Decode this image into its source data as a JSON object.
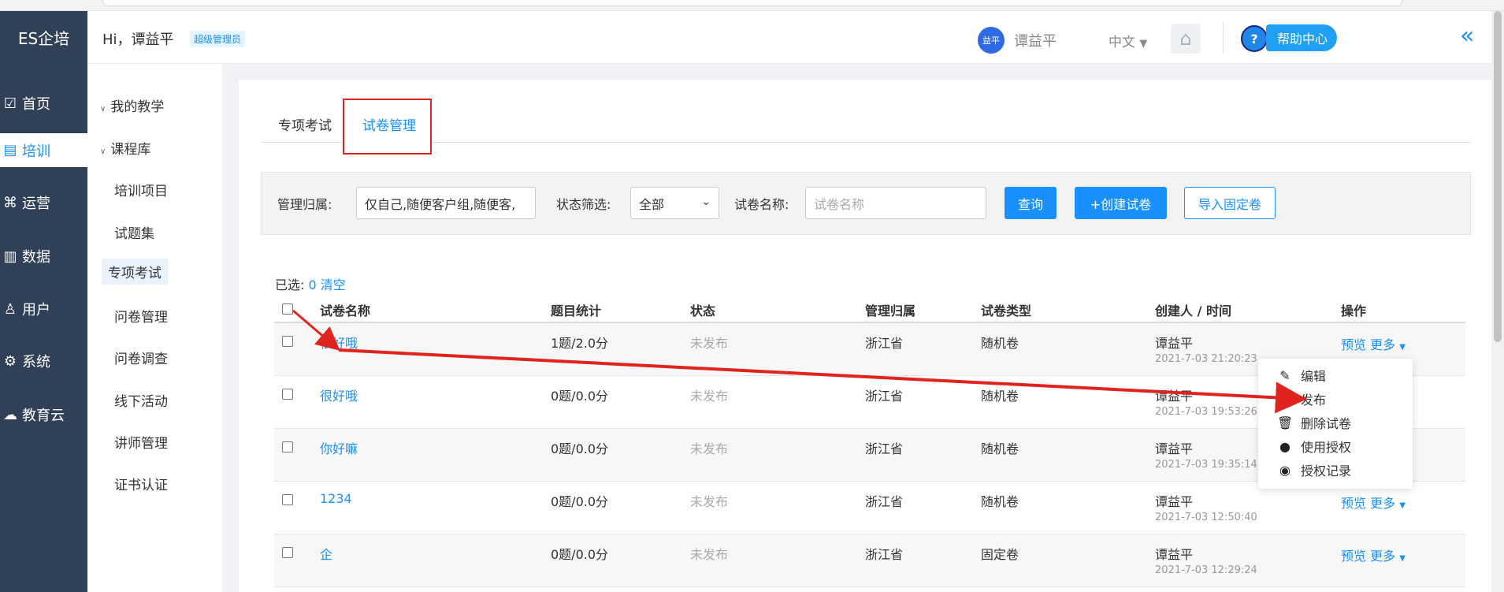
{
  "app": {
    "logo": "ES企培"
  },
  "sidebar": {
    "items": [
      {
        "label": "首页",
        "icon": "chart-icon"
      },
      {
        "label": "培训",
        "icon": "book-icon",
        "active": true
      },
      {
        "label": "运营",
        "icon": "command-icon"
      },
      {
        "label": "数据",
        "icon": "bars-icon"
      },
      {
        "label": "用户",
        "icon": "user-icon"
      },
      {
        "label": "系统",
        "icon": "gear-icon"
      },
      {
        "label": "教育云",
        "icon": "cloud-icon"
      }
    ]
  },
  "header": {
    "greeting": "Hi，谭益平",
    "role": "超级管理员",
    "avatar_text": "益平",
    "username": "谭益平",
    "language": "中文",
    "help": "帮助中心"
  },
  "submenu": {
    "groups": [
      "我的教学",
      "课程库"
    ],
    "items": [
      "培训项目",
      "试题集",
      "专项考试",
      "问卷管理",
      "问卷调查",
      "线下活动",
      "讲师管理",
      "证书认证"
    ]
  },
  "tabs": [
    "专项考试",
    "试卷管理"
  ],
  "filter": {
    "owner_label": "管理归属:",
    "owner_value": "仅自己,随便客户组,随便客,",
    "status_label": "状态筛选:",
    "status_value": "全部",
    "name_label": "试卷名称:",
    "name_placeholder": "试卷名称",
    "query_btn": "查询",
    "create_btn": "+创建试卷",
    "import_btn": "导入固定卷"
  },
  "selection": {
    "prefix": "已选:",
    "count": "0",
    "clear": "清空"
  },
  "table": {
    "headers": [
      "试卷名称",
      "题目统计",
      "状态",
      "管理归属",
      "试卷类型",
      "创建人 / 时间",
      "操作"
    ],
    "rows": [
      {
        "name": "很好哦",
        "stats": "1题/2.0分",
        "status": "未发布",
        "owner": "浙江省",
        "type": "随机卷",
        "creator": "谭益平",
        "time": "2021-7-03 21:20:23"
      },
      {
        "name": "很好哦",
        "stats": "0题/0.0分",
        "status": "未发布",
        "owner": "浙江省",
        "type": "随机卷",
        "creator": "谭益平",
        "time": "2021-7-03 19:53:26"
      },
      {
        "name": "你好嘛",
        "stats": "0题/0.0分",
        "status": "未发布",
        "owner": "浙江省",
        "type": "随机卷",
        "creator": "谭益平",
        "time": "2021-7-03 19:35:14"
      },
      {
        "name": "1234",
        "stats": "0题/0.0分",
        "status": "未发布",
        "owner": "浙江省",
        "type": "随机卷",
        "creator": "谭益平",
        "time": "2021-7-03 12:50:40"
      },
      {
        "name": "企",
        "stats": "0题/0.0分",
        "status": "未发布",
        "owner": "浙江省",
        "type": "固定卷",
        "creator": "谭益平",
        "time": "2021-7-03 12:29:24"
      }
    ],
    "op_preview": "预览",
    "op_more": "更多"
  },
  "dropdown": {
    "items": [
      {
        "label": "编辑",
        "icon": "edit-icon"
      },
      {
        "label": "发布",
        "icon": "check-circle-icon"
      },
      {
        "label": "删除试卷",
        "icon": "trash-icon"
      },
      {
        "label": "使用授权",
        "icon": "person-icon"
      },
      {
        "label": "授权记录",
        "icon": "eye-icon"
      }
    ]
  },
  "colors": {
    "sidebar_bg": "#2f4057",
    "accent": "#1890ff",
    "highlight_red": "#e0241d"
  }
}
